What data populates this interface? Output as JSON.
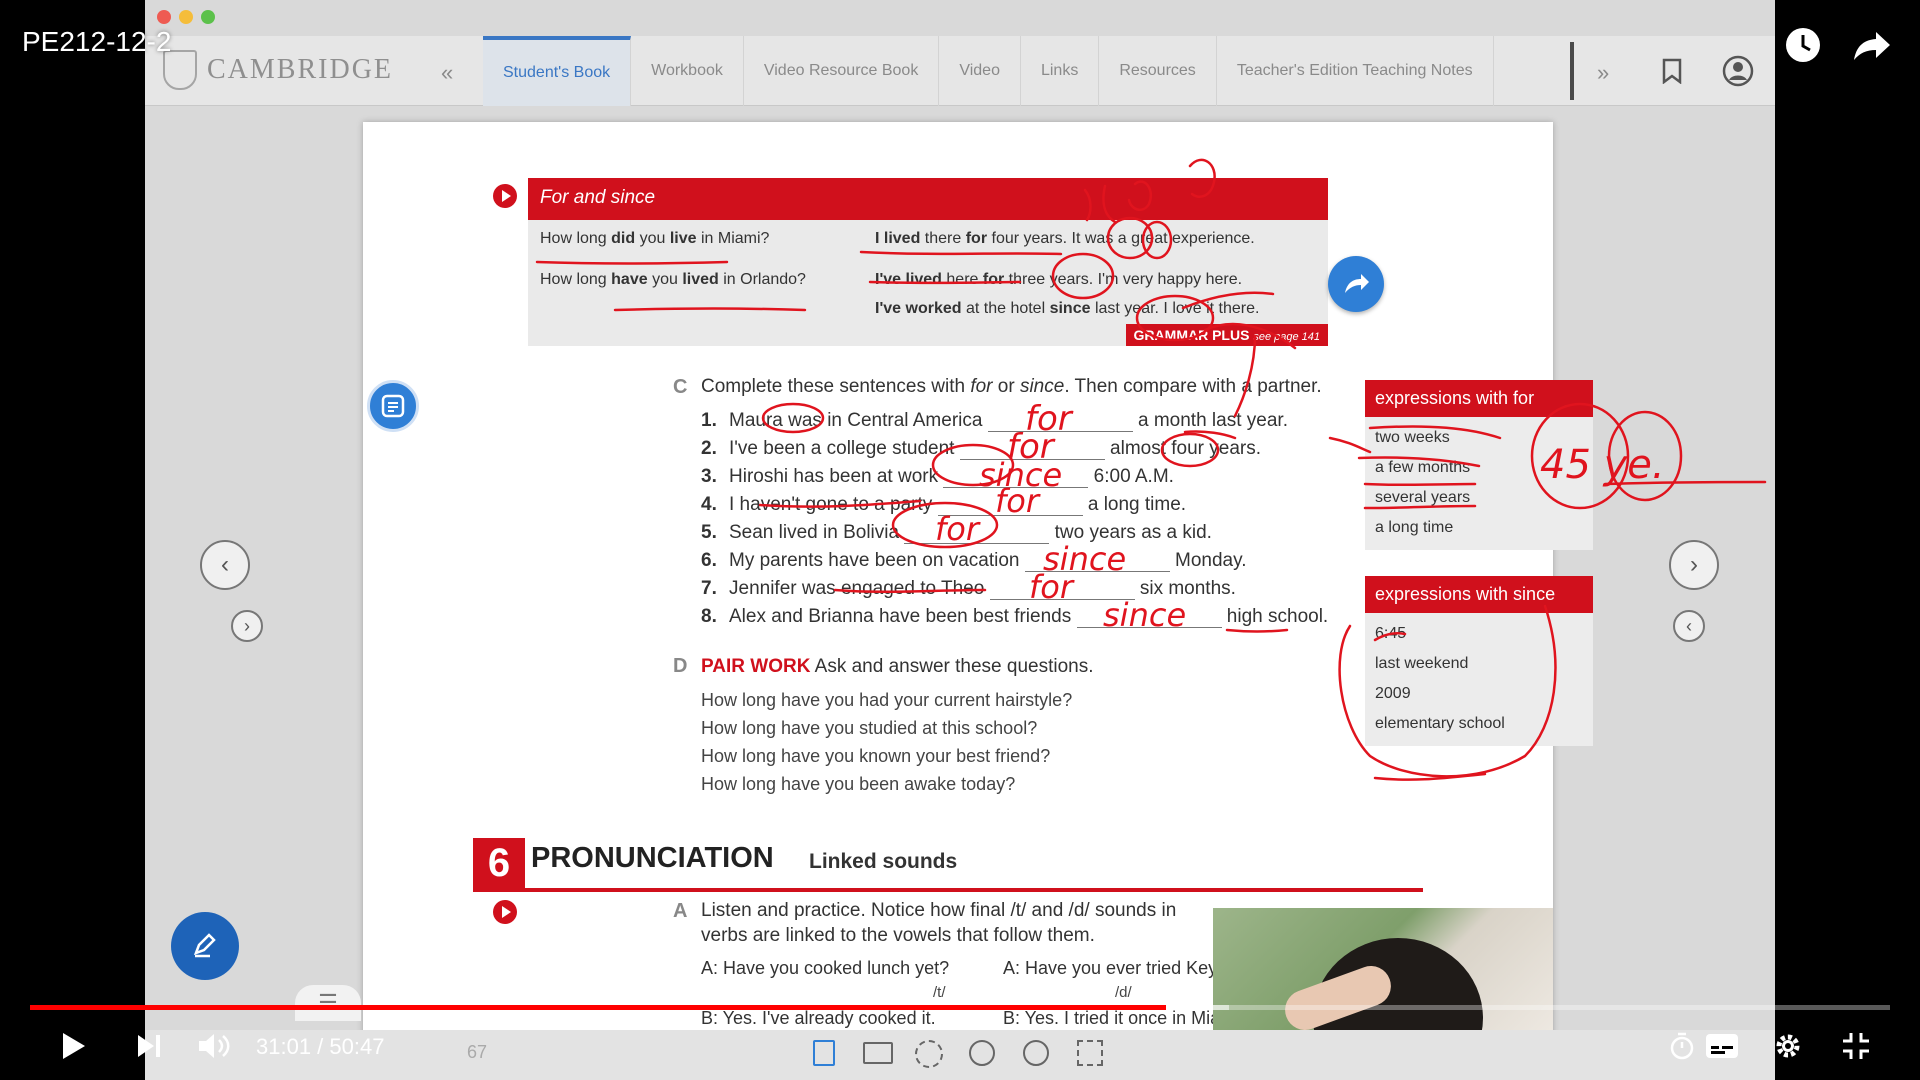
{
  "video": {
    "title": "PE212-12-2",
    "current_time": "31:01",
    "time_separator": " / ",
    "duration": "50:47",
    "progress_fraction": 0.6107,
    "buffered_fraction": 0.6447
  },
  "app": {
    "logo_text": "CAMBRIDGE",
    "tabs": [
      {
        "label": "Student's Book",
        "active": true
      },
      {
        "label": "Workbook"
      },
      {
        "label": "Video Resource Book"
      },
      {
        "label": "Video"
      },
      {
        "label": "Links"
      },
      {
        "label": "Resources"
      },
      {
        "label": "Teacher's Edition Teaching Notes"
      }
    ],
    "nav_prev": "«",
    "nav_next": "»"
  },
  "book": {
    "for_since": {
      "title": "For and since",
      "q1_parts": [
        "How long ",
        "did",
        " you ",
        "live",
        " in Miami?"
      ],
      "q2_parts": [
        "How long ",
        "have",
        " you ",
        "lived",
        " in Orlando?"
      ],
      "a1_parts": [
        "I lived",
        " there ",
        "for",
        " four years. It was a great experience."
      ],
      "a2_parts": [
        "I've lived",
        " here ",
        "for",
        " three years. I'm very happy here."
      ],
      "a3_parts": [
        "I've worked",
        " at the hotel ",
        "since",
        " last year. I love it there."
      ],
      "grammar_plus": "GRAMMAR PLUS",
      "grammar_plus_page": "see page 141"
    },
    "section_c": {
      "letter": "C",
      "instr_parts": [
        "Complete these sentences with ",
        "for",
        " or ",
        "since",
        ". Then compare with a partner."
      ],
      "sentences": [
        {
          "n": "1.",
          "before": "Maura was in Central America",
          "after": "a month last year."
        },
        {
          "n": "2.",
          "before": "I've been a college student",
          "after": "almost four years."
        },
        {
          "n": "3.",
          "before": "Hiroshi has been at work",
          "after": "6:00 A.M."
        },
        {
          "n": "4.",
          "before": "I haven't gone to a party",
          "after": "a long time."
        },
        {
          "n": "5.",
          "before": "Sean lived in Bolivia",
          "after": "two years as a kid."
        },
        {
          "n": "6.",
          "before": "My parents have been on vacation",
          "after": "Monday."
        },
        {
          "n": "7.",
          "before": "Jennifer was engaged to Theo",
          "after": "six months."
        },
        {
          "n": "8.",
          "before": "Alex and Brianna have been best friends",
          "after": "high school."
        }
      ]
    },
    "expr_for": {
      "title": "expressions with for",
      "items": [
        "two weeks",
        "a few months",
        "several years",
        "a long time"
      ]
    },
    "expr_since": {
      "title": "expressions with since",
      "items": [
        "6:45",
        "last weekend",
        "2009",
        "elementary school"
      ]
    },
    "section_d": {
      "letter": "D",
      "label": "PAIR WORK",
      "instr": "Ask and answer these questions.",
      "questions": [
        "How long have you had your current hairstyle?",
        "How long have you studied at this school?",
        "How long have you known your best friend?",
        "How long have you been awake today?"
      ]
    },
    "pronunciation": {
      "number": "6",
      "title": "PRONUNCIATION",
      "subtitle": "Linked sounds",
      "letter": "A",
      "instr1": "Listen and practice. Notice how final /t/ and /d/ sounds in",
      "instr2": "verbs are linked to the vowels that follow them.",
      "ex1": "A: Have you cooked lunch yet?",
      "ex1_mark": "/t/",
      "ex2": "A: Have you ever tried Key Lime Pie?",
      "ex2_mark": "/d/",
      "ex3": "B: Yes. I've already cooked it.",
      "ex4": "B: Yes. I tried it once in Miami."
    },
    "page_number": "67"
  },
  "annotations": {
    "blank1": "for",
    "blank2": "for",
    "blank3": "since",
    "blank4": "for",
    "blank5": "for",
    "blank6": "since",
    "blank7": "for",
    "blank8": "since",
    "margin_note": "45 ye."
  }
}
